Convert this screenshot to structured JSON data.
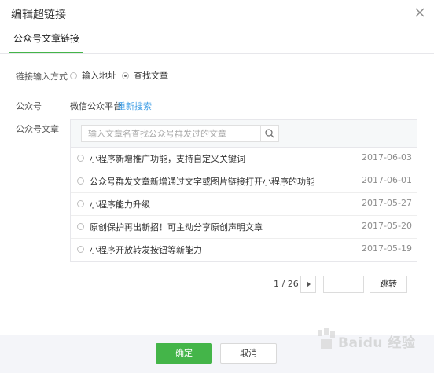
{
  "dialog": {
    "title": "编辑超链接",
    "close_icon": "close-icon"
  },
  "tabs": [
    {
      "label": "公众号文章链接",
      "active": true
    }
  ],
  "link_method": {
    "label": "链接输入方式",
    "options": [
      {
        "label": "输入地址",
        "selected": false
      },
      {
        "label": "查找文章",
        "selected": true
      }
    ]
  },
  "account": {
    "label": "公众号",
    "name": "微信公众平台",
    "re_search": "重新搜索"
  },
  "articles": {
    "label": "公众号文章",
    "search_placeholder": "输入文章名查找公众号群发过的文章",
    "search_icon": "search-icon",
    "items": [
      {
        "title": "小程序新增推广功能，支持自定义关键词",
        "date": "2017-06-03"
      },
      {
        "title": "公众号群发文章新增通过文字或图片链接打开小程序的功能",
        "date": "2017-06-01"
      },
      {
        "title": "小程序能力升级",
        "date": "2017-05-27"
      },
      {
        "title": "原创保护再出新招！可主动分享原创声明文章",
        "date": "2017-05-20"
      },
      {
        "title": "小程序开放转发按钮等新能力",
        "date": "2017-05-19"
      }
    ]
  },
  "pager": {
    "text": "1 / 26",
    "next_icon": "triangle-right-icon",
    "jump_label": "跳转"
  },
  "footer": {
    "ok_label": "确定",
    "cancel_label": "取消"
  },
  "watermark": {
    "text": "Baidu 经验"
  },
  "colors": {
    "accent": "#44b549",
    "link": "#44a0e6",
    "footer_bg": "#f4f5f9"
  }
}
